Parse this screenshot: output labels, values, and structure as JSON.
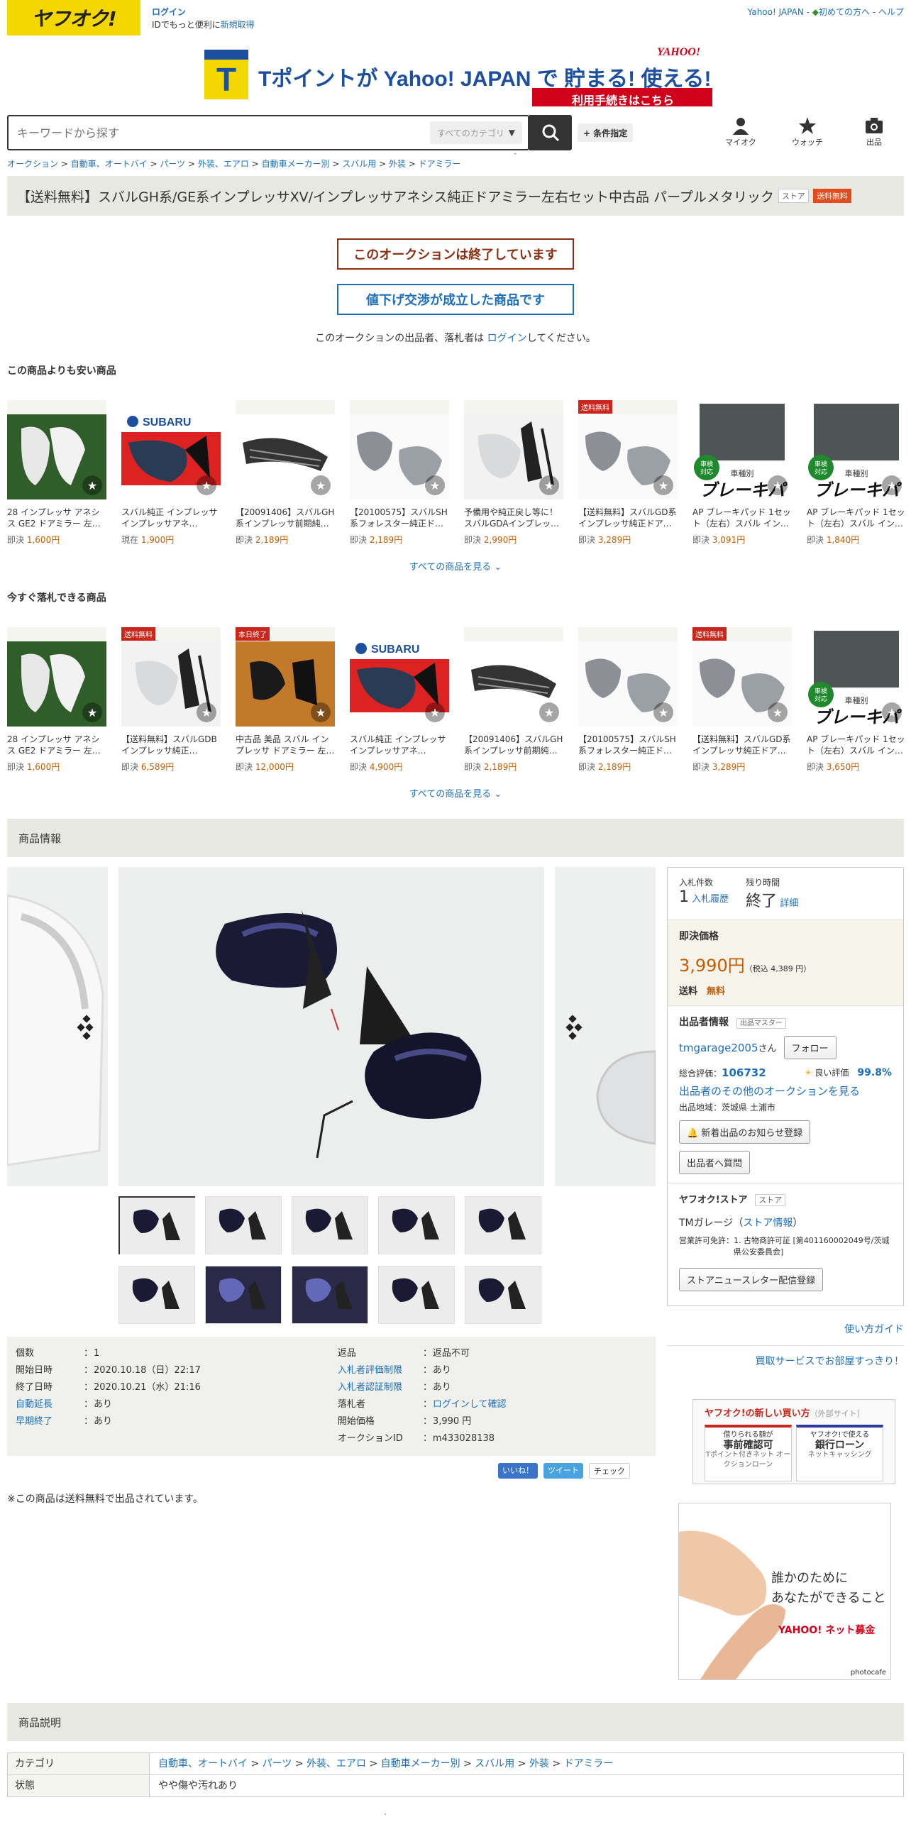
{
  "header": {
    "logo": "ヤフオク!",
    "login": "ログイン",
    "id_text": "IDでもっと便利に",
    "signup": "新規取得",
    "links": [
      "Yahoo! JAPAN",
      "初めての方へ",
      "ヘルプ"
    ],
    "banner_text": "Tポイントが Yahoo! JAPAN で 貯まる! 使える!",
    "banner_sub": "利用手続きはこちら",
    "search_placeholder": "キーワードから探す",
    "category_select": "すべてのカテゴリ",
    "condition_button": "+ 条件指定",
    "icons": [
      {
        "label": "マイオク"
      },
      {
        "label": "ウォッチ"
      },
      {
        "label": "出品"
      }
    ]
  },
  "breadcrumb": [
    "オークション",
    "自動車、オートバイ",
    "パーツ",
    "外装、エアロ",
    "自動車メーカー別",
    "スバル用",
    "外装",
    "ドアミラー"
  ],
  "title": "【送料無料】スバルGH系/GE系インプレッサXV/インプレッサアネシス純正ドアミラー左右セット中古品 パープルメタリック",
  "title_tags": [
    "ストア",
    "送料無料"
  ],
  "status": {
    "ended": "このオークションは終了しています",
    "negotiated": "値下げ交渉が成立した商品です",
    "login_msg_pre": "このオークションの出品者、落札者は ",
    "login_link": "ログイン",
    "login_msg_post": "してください。"
  },
  "cheaper": {
    "heading": "この商品よりも安い商品",
    "see_all": "すべての商品を見る",
    "items": [
      {
        "name": "28 インプレッサ アネシス GE2 ドアミラー 左…",
        "price_label": "即決",
        "price": "1,600円",
        "badge": "",
        "img": "white-mirror"
      },
      {
        "name": "スバル純正 インプレッサ インプレッサアネ…",
        "price_label": "現在",
        "price": "1,900円",
        "badge": "",
        "img": "subaru"
      },
      {
        "name": "【20091406】スバルGH系インプレッサ前期純…",
        "price_label": "即決",
        "price": "2,189円",
        "badge": "",
        "img": "grille"
      },
      {
        "name": "【20100575】スバルSH系フォレスター純正ド…",
        "price_label": "即決",
        "price": "2,189円",
        "badge": "",
        "img": "covers"
      },
      {
        "name": "予備用や純正戻し等に！スバルGDAインプレッ…",
        "price_label": "即決",
        "price": "2,990円",
        "badge": "",
        "img": "silver-mirror"
      },
      {
        "name": "【送料無料】スバルGD系インプレッサ純正ドア…",
        "price_label": "即決",
        "price": "3,289円",
        "badge": "送料無料",
        "img": "covers"
      },
      {
        "name": "AP ブレーキパッド 1セット（左右）スバル イン…",
        "price_label": "即決",
        "price": "3,091円",
        "badge": "",
        "img": "brake"
      },
      {
        "name": "AP ブレーキパッド 1セット（左右）スバル イン…",
        "price_label": "即決",
        "price": "1,840円",
        "badge": "",
        "img": "brake"
      }
    ]
  },
  "buynow": {
    "heading": "今すぐ落札できる商品",
    "see_all": "すべての商品を見る",
    "items": [
      {
        "name": "28 インプレッサ アネシス GE2 ドアミラー 左…",
        "price_label": "即決",
        "price": "1,600円",
        "badge": "",
        "img": "white-mirror"
      },
      {
        "name": "【送料無料】スバルGDB インプレッサ純正…",
        "price_label": "即決",
        "price": "6,589円",
        "badge": "送料無料",
        "img": "silver-mirror"
      },
      {
        "name": "中古品 美品 スバル インプレッサ ドアミラー 左…",
        "price_label": "即決",
        "price": "12,000円",
        "badge": "本日終了",
        "img": "orange"
      },
      {
        "name": "スバル純正 インプレッサ インプレッサアネ…",
        "price_label": "即決",
        "price": "4,900円",
        "badge": "",
        "img": "subaru"
      },
      {
        "name": "【20091406】スバルGH系インプレッサ前期純…",
        "price_label": "即決",
        "price": "2,189円",
        "badge": "",
        "img": "grille"
      },
      {
        "name": "【20100575】スバルSH系フォレスター純正ド…",
        "price_label": "即決",
        "price": "2,189円",
        "badge": "",
        "img": "covers"
      },
      {
        "name": "【送料無料】スバルGD系インプレッサ純正ドア…",
        "price_label": "即決",
        "price": "3,289円",
        "badge": "送料無料",
        "img": "covers"
      },
      {
        "name": "AP ブレーキパッド 1セット（左右）スバル イン…",
        "price_label": "即決",
        "price": "3,650円",
        "badge": "",
        "img": "brake"
      }
    ]
  },
  "brake_img_text": {
    "top": "車種別",
    "main": "ブレーキパ",
    "badge": "車検対応"
  },
  "product_info_heading": "商品情報",
  "side": {
    "bids_label": "入札件数",
    "bids": "1",
    "bid_history": "入札履歴",
    "time_label": "残り時間",
    "time": "終了",
    "detail": "詳細",
    "buynow_label": "即決価格",
    "price": "3,990円",
    "tax": "（税込 4,389 円）",
    "shipping_label": "送料",
    "shipping": "無料",
    "seller_heading": "出品者情報",
    "seller_badge": "出品マスター",
    "seller_name": "tmgarage2005",
    "seller_suffix": "さん",
    "follow": "フォロー",
    "rating_label": "総合評価：",
    "rating": "106732",
    "good_label": "良い評価",
    "good_pct": "99.8%",
    "other_auctions": "出品者のその他のオークションを見る",
    "region": "出品地域：茨城県 土浦市",
    "notify": "新着出品のお知らせ登録",
    "question": "出品者へ質問",
    "store_heading": "ヤフオク!ストア",
    "store_tag": "ストア",
    "store_name": "TMガレージ",
    "store_info": "ストア情報",
    "license_label": "営業許可免許：",
    "license": "1. 古物商許可証 [第401160002049号/茨城県公安委員会]",
    "newsletter": "ストアニュースレター配信登録"
  },
  "info": {
    "left": [
      {
        "k": "個数",
        "v": "1",
        "link": false
      },
      {
        "k": "開始日時",
        "v": "2020.10.18（日）22:17",
        "link": false
      },
      {
        "k": "終了日時",
        "v": "2020.10.21（水）21:16",
        "link": false
      },
      {
        "k": "自動延長",
        "v": "あり",
        "link": true
      },
      {
        "k": "早期終了",
        "v": "あり",
        "link": true
      }
    ],
    "right": [
      {
        "k": "返品",
        "v": "返品不可",
        "link": false,
        "vlink": false
      },
      {
        "k": "入札者評価制限",
        "v": "あり",
        "link": true,
        "vlink": false
      },
      {
        "k": "入札者認証制限",
        "v": "あり",
        "link": true,
        "vlink": false
      },
      {
        "k": "落札者",
        "v": "ログインして確認",
        "link": false,
        "vlink": true
      },
      {
        "k": "開始価格",
        "v": "3,990 円",
        "link": false,
        "vlink": false
      },
      {
        "k": "オークションID",
        "v": "m433028138",
        "link": false,
        "vlink": false
      }
    ]
  },
  "socials": [
    "いいね！",
    "ツイート",
    "チェック"
  ],
  "free_ship_note": "※この商品は送料無料で出品されています。",
  "right_links": [
    "使い方ガイド",
    "買取サービスでお部屋すっきり！"
  ],
  "payad": {
    "title": "ヤフオク!の新しい買い方",
    "sub": "（外部サイト）",
    "b1_top": "借りられる額が",
    "b1_main": "事前確認可",
    "b1_sub": "Tポイント付きネット オークションローン",
    "b2_top": "ヤフオク!で使える",
    "b2_main": "銀行ローン",
    "b2_sub": "ネットキャッシング"
  },
  "donation": {
    "line1": "誰かのために",
    "line2": "あなたができること",
    "brand": "YAHOO! ネット募金",
    "credit": "photocafe"
  },
  "desc_heading": "商品説明",
  "desc": {
    "cat_label": "カテゴリ",
    "cat_path": [
      "自動車、オートバイ",
      "パーツ",
      "外装、エアロ",
      "自動車メーカー別",
      "スバル用",
      "外装",
      "ドアミラー"
    ],
    "cond_label": "状態",
    "cond": "やや傷や汚れあり"
  },
  "colors": {
    "accent": "#1d6fbd",
    "price": "#c65c00",
    "yahoo_yellow": "#f5d700",
    "red": "#c9271b"
  }
}
